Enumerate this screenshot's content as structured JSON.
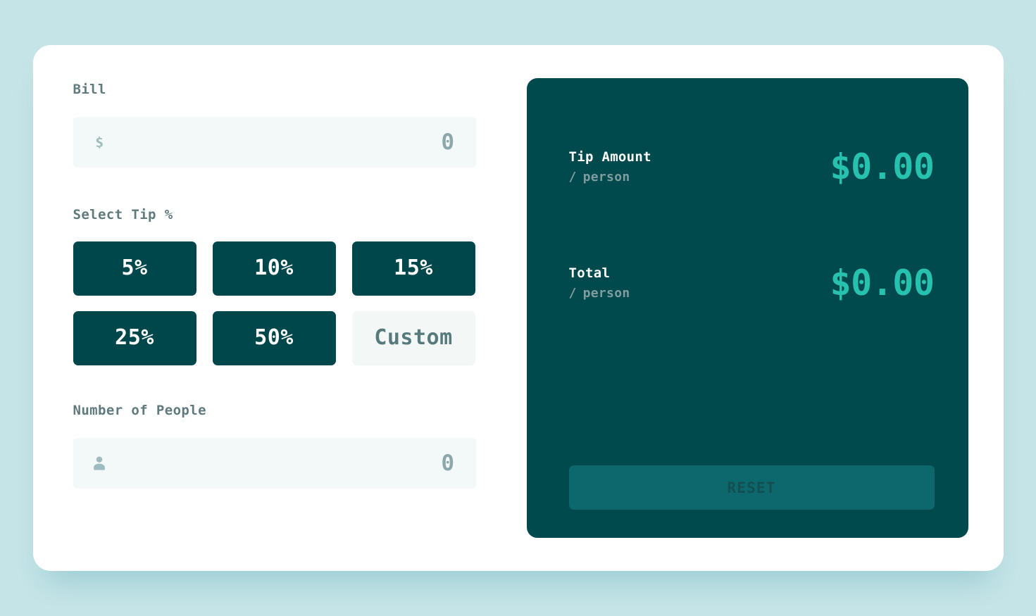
{
  "bill": {
    "label": "Bill",
    "icon": "dollar-icon",
    "value": "0",
    "placeholder": "0"
  },
  "tip": {
    "label": "Select Tip %",
    "options": [
      {
        "label": "5%",
        "value": 5
      },
      {
        "label": "10%",
        "value": 10
      },
      {
        "label": "15%",
        "value": 15
      },
      {
        "label": "25%",
        "value": 25
      },
      {
        "label": "50%",
        "value": 50
      }
    ],
    "custom": {
      "label": "Custom",
      "placeholder": "Custom",
      "value": ""
    }
  },
  "people": {
    "label": "Number of People",
    "icon": "person-icon",
    "value": "0",
    "placeholder": "0"
  },
  "results": {
    "tip_amount": {
      "title": "Tip Amount",
      "slash": "/",
      "unit": "person",
      "amount": "$0.00"
    },
    "total": {
      "title": "Total",
      "slash": "/",
      "unit": "person",
      "amount": "$0.00"
    },
    "reset_label": "RESET"
  },
  "colors": {
    "page_background": "#c5e4e7",
    "card_background": "#ffffff",
    "dark_panel": "#00494d",
    "tip_button": "#00474b",
    "accent_amount": "#26c2ae",
    "label_text": "#5e7a7d",
    "input_background": "#f3f8f8",
    "reset_background": "#0d686d",
    "reset_text": "#124e52"
  }
}
